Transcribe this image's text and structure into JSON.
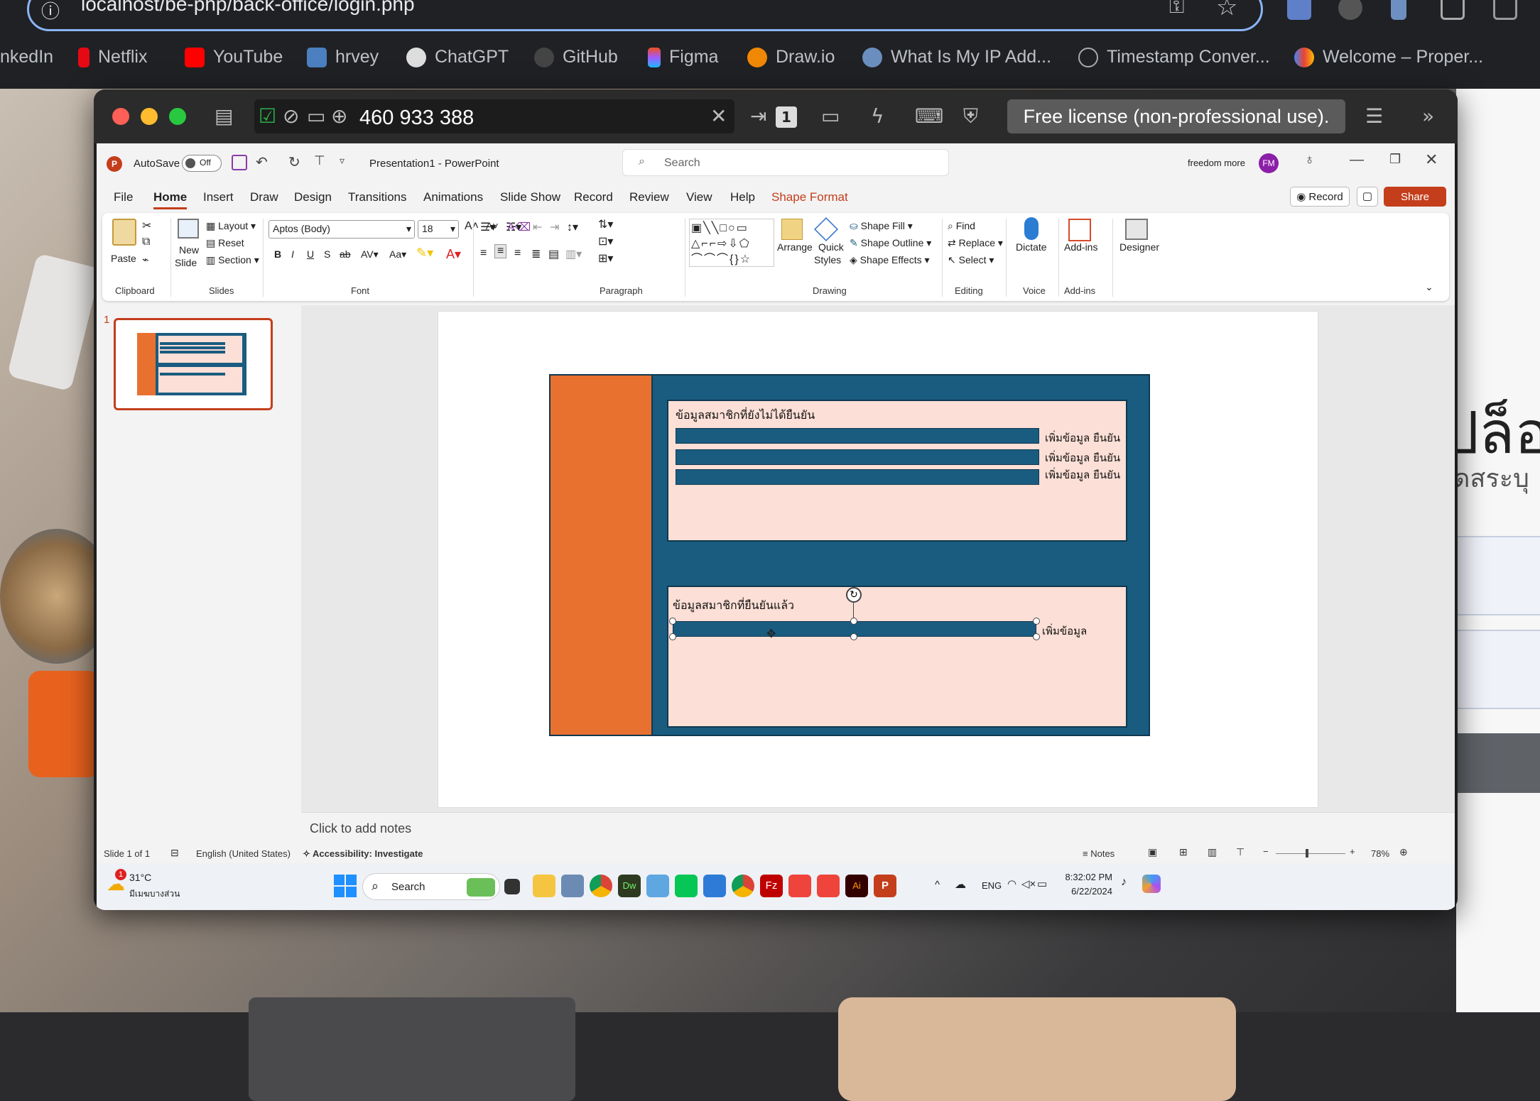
{
  "browser": {
    "url": "localhost/be-php/back-office/login.php",
    "bookmarks": [
      "nkedIn",
      "Netflix",
      "YouTube",
      "hrvey",
      "ChatGPT",
      "GitHub",
      "Figma",
      "Draw.io",
      "What Is My IP Add...",
      "Timestamp Conver...",
      "Welcome – Proper..."
    ]
  },
  "background_page": {
    "heading_fragment": "ปล็อ",
    "sub_fragment": "ัดสระบุ"
  },
  "anydesk": {
    "remote_id": "460 933 388",
    "license": "Free license (non-professional use).",
    "monitor_index": "1"
  },
  "powerpoint": {
    "autosave_label": "AutoSave",
    "autosave_state": "Off",
    "doc_title": "Presentation1  -  PowerPoint",
    "search_placeholder": "Search",
    "user_name": "freedom more",
    "user_initials": "FM",
    "tabs": [
      "File",
      "Home",
      "Insert",
      "Draw",
      "Design",
      "Transitions",
      "Animations",
      "Slide Show",
      "Record",
      "Review",
      "View",
      "Help",
      "Shape Format"
    ],
    "record_button": "Record",
    "share_button": "Share",
    "ribbon": {
      "paste": "Paste",
      "new_slide": "New Slide",
      "new_slide_line1": "New",
      "new_slide_line2": "Slide",
      "layout": "Layout",
      "reset": "Reset",
      "section": "Section",
      "font_name": "Aptos (Body)",
      "font_size": "18",
      "arrange": "Arrange",
      "quick_styles_line1": "Quick",
      "quick_styles_line2": "Styles",
      "shape_fill": "Shape Fill",
      "shape_outline": "Shape Outline",
      "shape_effects": "Shape Effects",
      "find": "Find",
      "replace": "Replace",
      "select": "Select",
      "dictate": "Dictate",
      "addins": "Add-ins",
      "designer": "Designer",
      "groups": [
        "Clipboard",
        "Slides",
        "Font",
        "Paragraph",
        "Drawing",
        "Editing",
        "Voice",
        "Add-ins"
      ]
    },
    "slide_number": "1",
    "slide": {
      "box1_title": "ข้อมูลสมาชิกที่ยังไม่ได้ยืนยัน",
      "box1_rows": [
        {
          "action1": "เพิ่มข้อมูล",
          "action2": "ยืนยัน"
        },
        {
          "action1": "เพิ่มข้อมูล",
          "action2": "ยืนยัน"
        },
        {
          "action1": "เพิ่มข้อมูล",
          "action2": "ยืนยัน"
        }
      ],
      "box2_title": "ข้อมูลสมาชิกที่ยืนยันแล้ว",
      "box2_row_action": "เพิ่มข้อมูล"
    },
    "notes_placeholder": "Click to add notes",
    "status": {
      "slide_info": "Slide 1 of 1",
      "language": "English (United States)",
      "accessibility": "Accessibility: Investigate",
      "notes": "Notes",
      "zoom": "78%"
    },
    "colors": {
      "orange": "#e87130",
      "navy": "#1a5c80",
      "peach": "#fcdfd6",
      "accent": "#c43e1c"
    }
  },
  "taskbar": {
    "weather_temp": "31°C",
    "weather_desc": "มีเมฆบางส่วน",
    "weather_badge": "1",
    "search": "Search",
    "lang": "ENG",
    "time": "8:32:02 PM",
    "date": "6/22/2024"
  }
}
